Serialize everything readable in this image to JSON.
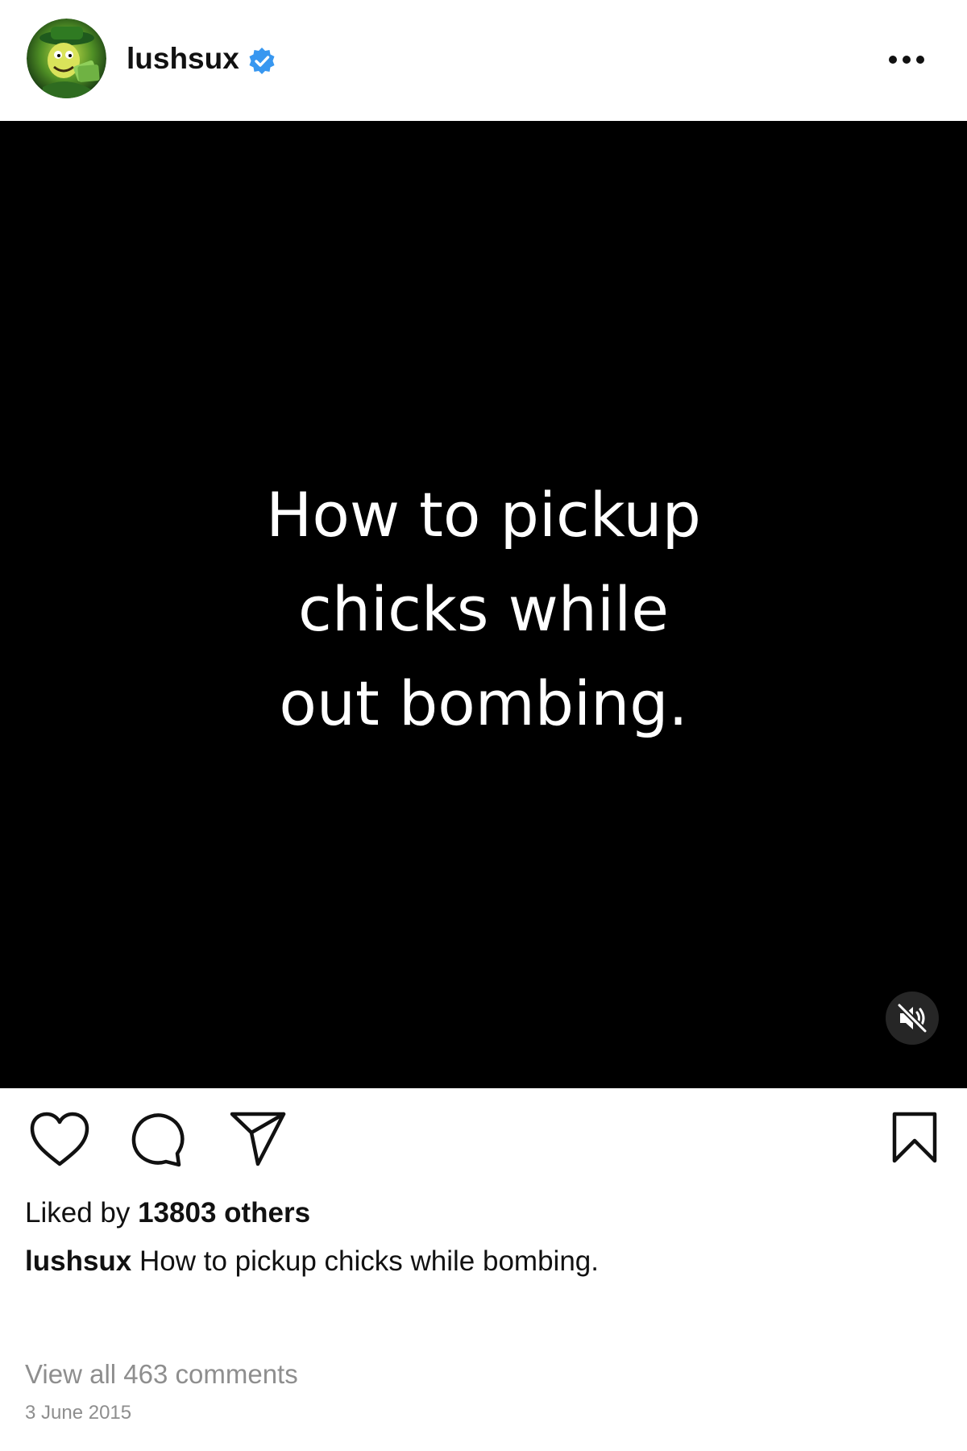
{
  "post": {
    "username": "lushsux",
    "verified": true,
    "more_icon": "more-horizontal-icon"
  },
  "media": {
    "text_lines": [
      "How to pickup",
      "chicks while",
      "out bombing."
    ],
    "background_color": "#000000",
    "mute_icon": "speaker-muted-icon"
  },
  "actions": {
    "like_icon": "heart-icon",
    "comment_icon": "comment-bubble-icon",
    "share_icon": "paper-plane-icon",
    "save_icon": "bookmark-icon"
  },
  "likes": {
    "prefix": "Liked by ",
    "count_text": "13803 others"
  },
  "caption": {
    "username": "lushsux",
    "text": " How to pickup chicks while bombing."
  },
  "comments": {
    "view_all": "View all 463 comments"
  },
  "date": "3 June 2015",
  "colors": {
    "verified_badge": "#3897f0",
    "secondary_text": "#8e8e8e",
    "primary_text": "#111111"
  }
}
